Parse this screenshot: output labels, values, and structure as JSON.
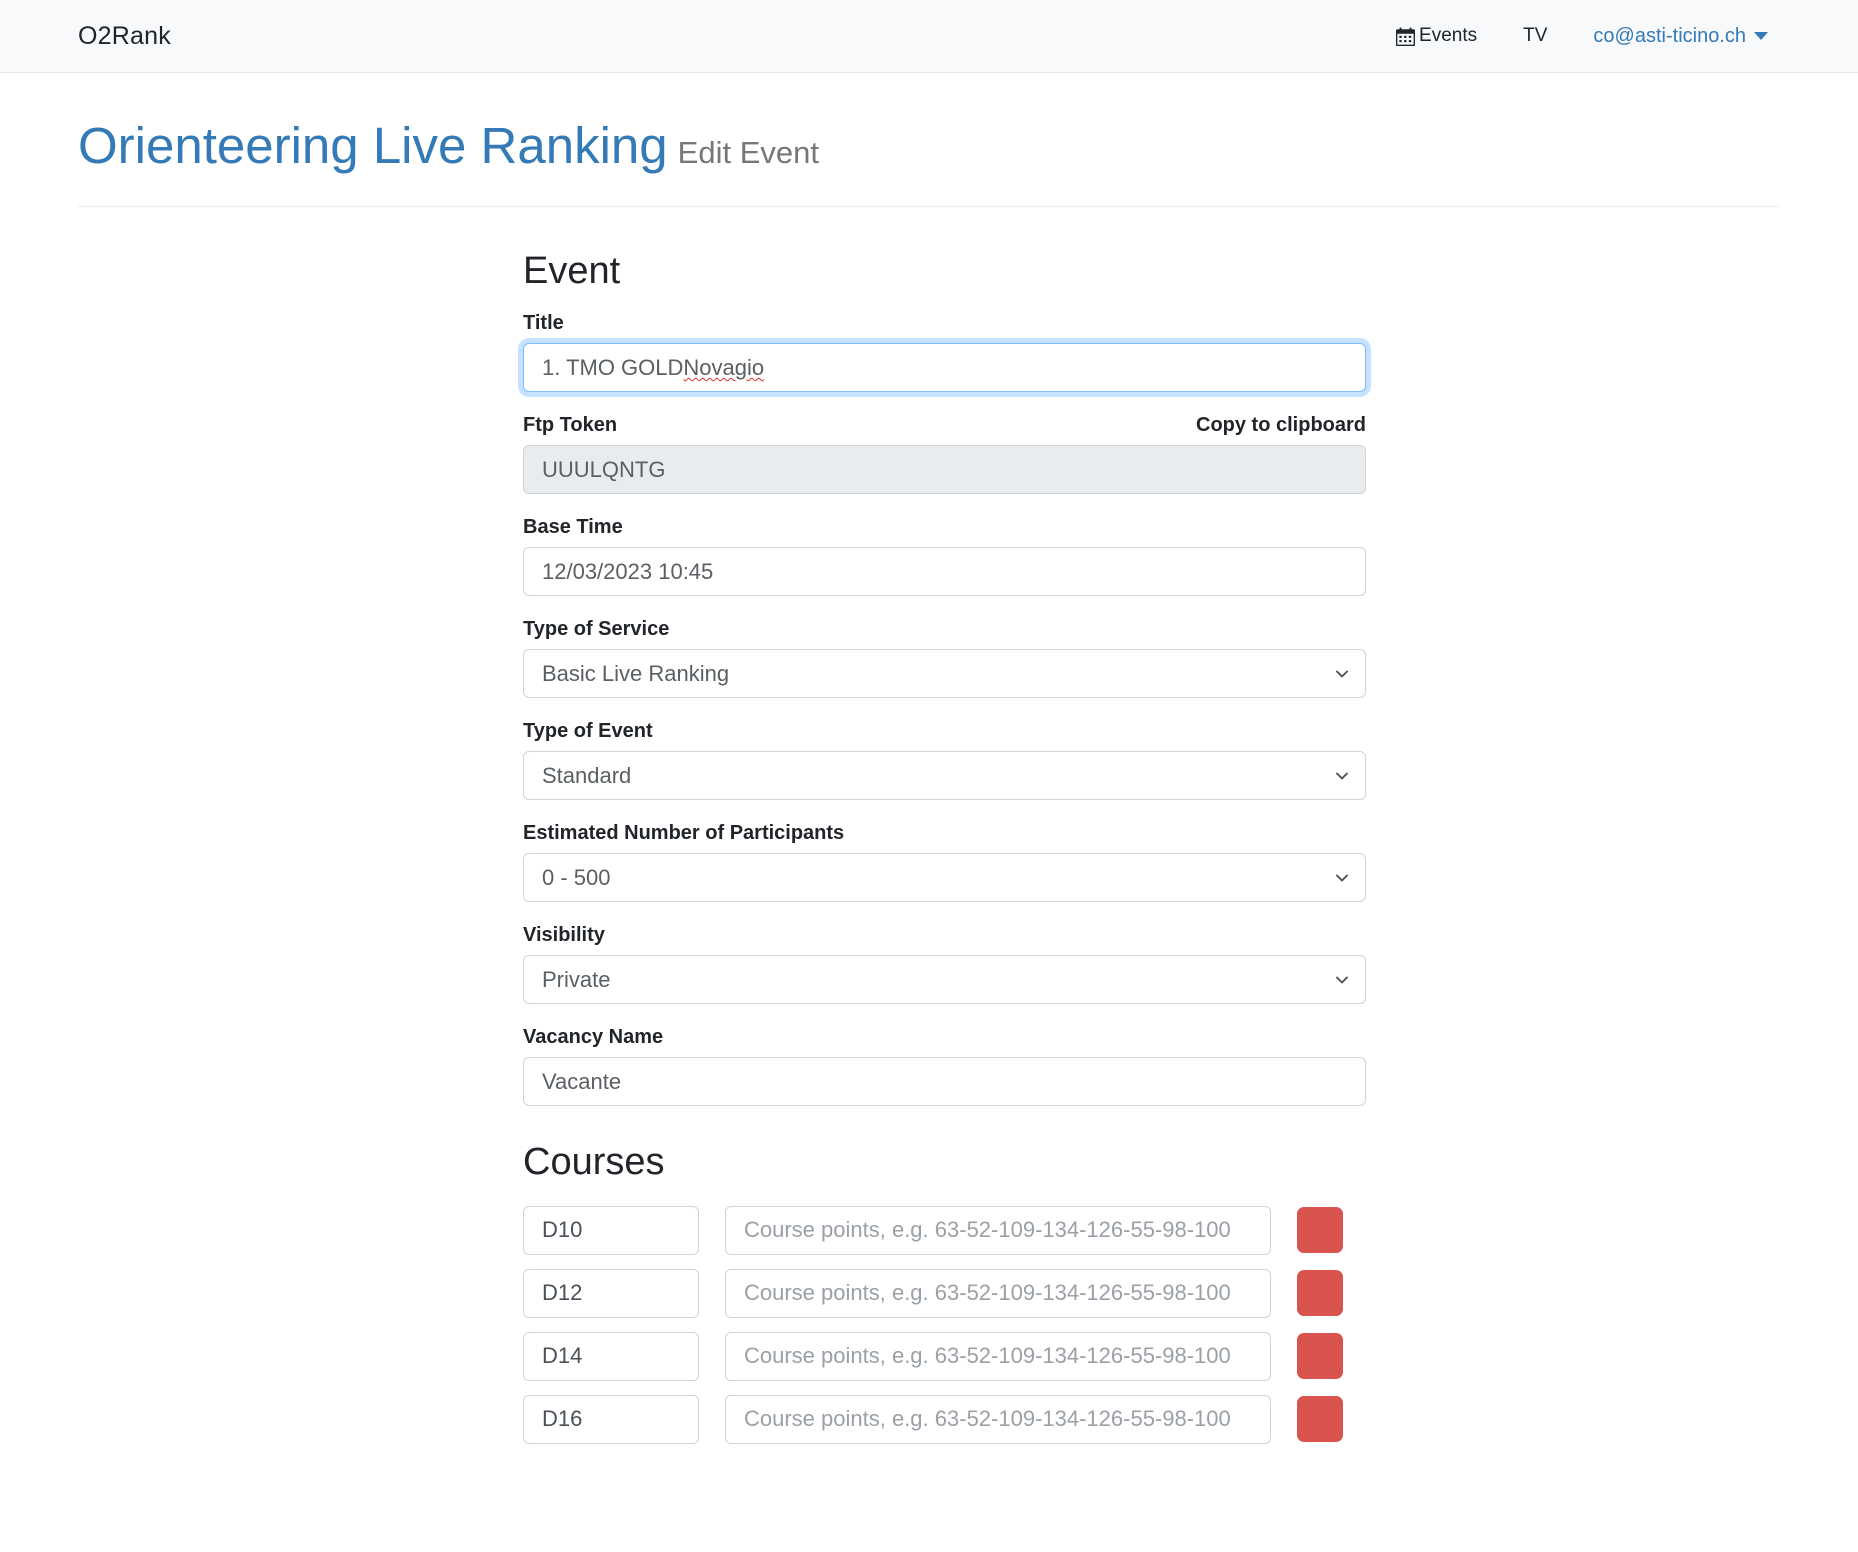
{
  "navbar": {
    "brand": "O2Rank",
    "events_label": "Events",
    "events_icon": "calendar-icon",
    "tv_label": "TV",
    "user_label": "co@asti-ticino.ch",
    "caret_icon": "caret-down-icon",
    "link_color": "#337ab7",
    "background": "#f8f9fa"
  },
  "header": {
    "title": "Orienteering Live Ranking",
    "subtitle": "Edit Event",
    "title_color": "#337ab7",
    "subtitle_color": "#777777"
  },
  "event_section": {
    "heading": "Event",
    "title": {
      "label": "Title",
      "value": "1. TMO GOLD Novagio",
      "value_plain": "1. TMO GOLD ",
      "value_misspelled": "Novagio",
      "focused": true
    },
    "ftp_token": {
      "label": "Ftp Token",
      "copy_label": "Copy to clipboard",
      "value": "UUULQNTG",
      "disabled": true
    },
    "base_time": {
      "label": "Base Time",
      "value": "12/03/2023 10:45"
    },
    "type_of_service": {
      "label": "Type of Service",
      "value": "Basic Live Ranking"
    },
    "type_of_event": {
      "label": "Type of Event",
      "value": "Standard"
    },
    "participants": {
      "label": "Estimated Number of Participants",
      "value": "0 - 500"
    },
    "visibility": {
      "label": "Visibility",
      "value": "Private"
    },
    "vacancy_name": {
      "label": "Vacancy Name",
      "value": "Vacante"
    }
  },
  "courses_section": {
    "heading": "Courses",
    "points_placeholder": "Course points, e.g. 63-52-109-134-126-55-98-100",
    "delete_color": "#d9534f",
    "rows": [
      {
        "name": "D10",
        "points": ""
      },
      {
        "name": "D12",
        "points": ""
      },
      {
        "name": "D14",
        "points": ""
      },
      {
        "name": "D16",
        "points": ""
      }
    ]
  }
}
